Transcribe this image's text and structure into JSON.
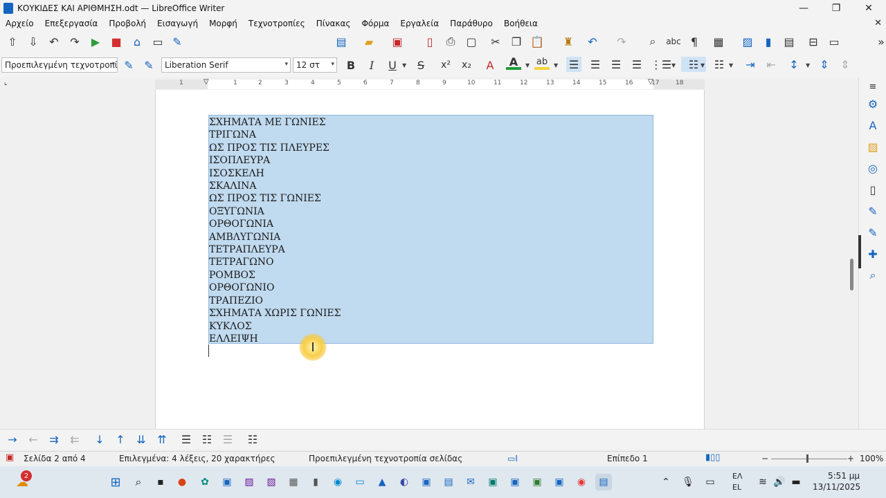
{
  "window": {
    "title": "ΚΟΥΚΙΔΕΣ ΚΑΙ ΑΡΙΘΜΗΣΗ.odt — LibreOffice Writer",
    "minimize": "—",
    "restore": "❐",
    "close": "✕"
  },
  "menu": [
    "Αρχείο",
    "Επεξεργασία",
    "Προβολή",
    "Εισαγωγή",
    "Μορφή",
    "Τεχνοτροπίες",
    "Πίνακας",
    "Φόρμα",
    "Εργαλεία",
    "Παράθυρο",
    "Βοήθεια"
  ],
  "format_bar": {
    "paragraph_style": "Προεπιλεγμένη τεχνοτροπί",
    "font_name": "Liberation Serif",
    "font_size": "12 στ"
  },
  "ruler": [
    "1",
    "1",
    "2",
    "3",
    "4",
    "5",
    "6",
    "7",
    "8",
    "9",
    "10",
    "11",
    "12",
    "13",
    "14",
    "15",
    "16",
    "17",
    "18"
  ],
  "document": {
    "lines": [
      "ΣΧΗΜΑΤΑ ΜΕ ΓΩΝΙΕΣ",
      "ΤΡΙΓΩΝΑ",
      "ΩΣ ΠΡΟΣ ΤΙΣ ΠΛΕΥΡΕΣ",
      "ΙΣΟΠΛΕΥΡΑ",
      "ΙΣΟΣΚΕΛΗ",
      "ΣΚΑΛΙΝΑ",
      "ΩΣ ΠΡΟΣ ΤΙΣ ΓΩΝΙΕΣ",
      "ΟΞΥΓΩΝΙΑ",
      "ΟΡΘΟΓΩΝΙΑ",
      "ΑΜΒΛΥΓΩΝΙΑ",
      "ΤΕΤΡΑΠΛΕΥΡΑ",
      "ΤΕΤΡΑΓΩΝΟ",
      "ΡΟΜΒΟΣ",
      "ΟΡΘΟΓΩΝΙΟ",
      "ΤΡΑΠΕΖΙΟ",
      "ΣΧΗΜΑΤΑ ΧΩΡΙΣ ΓΩΝΙΕΣ",
      "ΚΥΚΛΟΣ",
      "ΕΛΛΕΙΨΗ"
    ]
  },
  "status": {
    "page": "Σελίδα 2 από 4",
    "selection": "Επιλεγμένα: 4 λέξεις, 20 χαρακτήρες",
    "page_style": "Προεπιλεγμένη τεχνοτροπία σελίδας",
    "outline_level": "Επίπεδο 1",
    "zoom": "100%",
    "zoom_minus": "−",
    "zoom_plus": "+"
  },
  "taskbar": {
    "notification_count": "2",
    "lang_top": "ΕΛ",
    "lang_bottom": "EL",
    "time": "5:51 μμ",
    "date": "13/11/2025"
  },
  "colors": {
    "selection": "#c0daef",
    "font_color": "#1e9e3a",
    "highlight": "#f5d33a",
    "accent": "#1565c0"
  },
  "icons": {
    "toolbar1": [
      "arrow-up-icon",
      "arrow-down-icon",
      "undo-icon",
      "redo-icon",
      "start-icon",
      "stop-icon",
      "home-icon",
      "new-doc-icon",
      "spellcheck-icon"
    ],
    "toolbar1_right": [
      "new-icon",
      "open-icon",
      "save-icon",
      "export-pdf-icon",
      "print-icon",
      "print-preview-icon",
      "cut-icon",
      "copy-icon",
      "paste-icon",
      "clone-format-icon",
      "undo-icon",
      "redo-icon",
      "find-replace-icon",
      "spelling-icon",
      "formatting-marks-icon",
      "table-icon",
      "image-icon",
      "chart-icon",
      "text-box-icon",
      "page-break-icon",
      "field-icon"
    ]
  }
}
